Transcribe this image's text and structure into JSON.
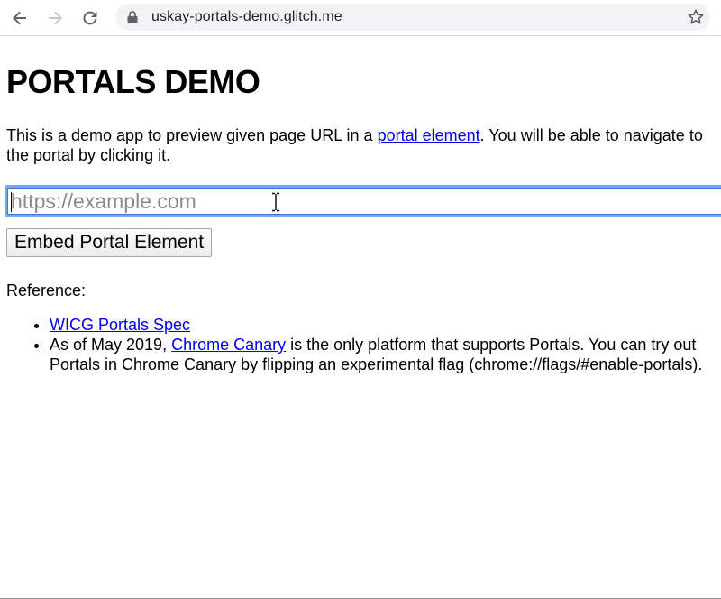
{
  "browser": {
    "url": "uskay-portals-demo.glitch.me",
    "icons": {
      "back": "arrow-left-icon",
      "forward": "arrow-right-icon",
      "reload": "reload-icon",
      "secure": "lock-icon",
      "bookmark": "star-icon"
    }
  },
  "page": {
    "title": "PORTALS DEMO",
    "intro": {
      "before": "This is a demo app to preview given page URL in a ",
      "link": "portal element",
      "after": ". You will be able to navigate to the portal by clicking it."
    },
    "url_input": {
      "placeholder": "https://example.com",
      "value": ""
    },
    "embed_button": "Embed Portal Element",
    "reference": {
      "label": "Reference:",
      "items": [
        {
          "link": "WICG Portals Spec"
        },
        {
          "before": "As of May 2019, ",
          "link": "Chrome Canary",
          "after": " is the only platform that supports Portals. You can try out Portals in Chrome Canary by flipping an experimental flag (chrome://flags/#enable-portals)."
        }
      ]
    }
  },
  "colors": {
    "link": "#0000ee",
    "focus_ring": "#7aa9ea",
    "toolbar_icon": "#5f6368",
    "omnibox_bg": "#f1f3f4"
  }
}
